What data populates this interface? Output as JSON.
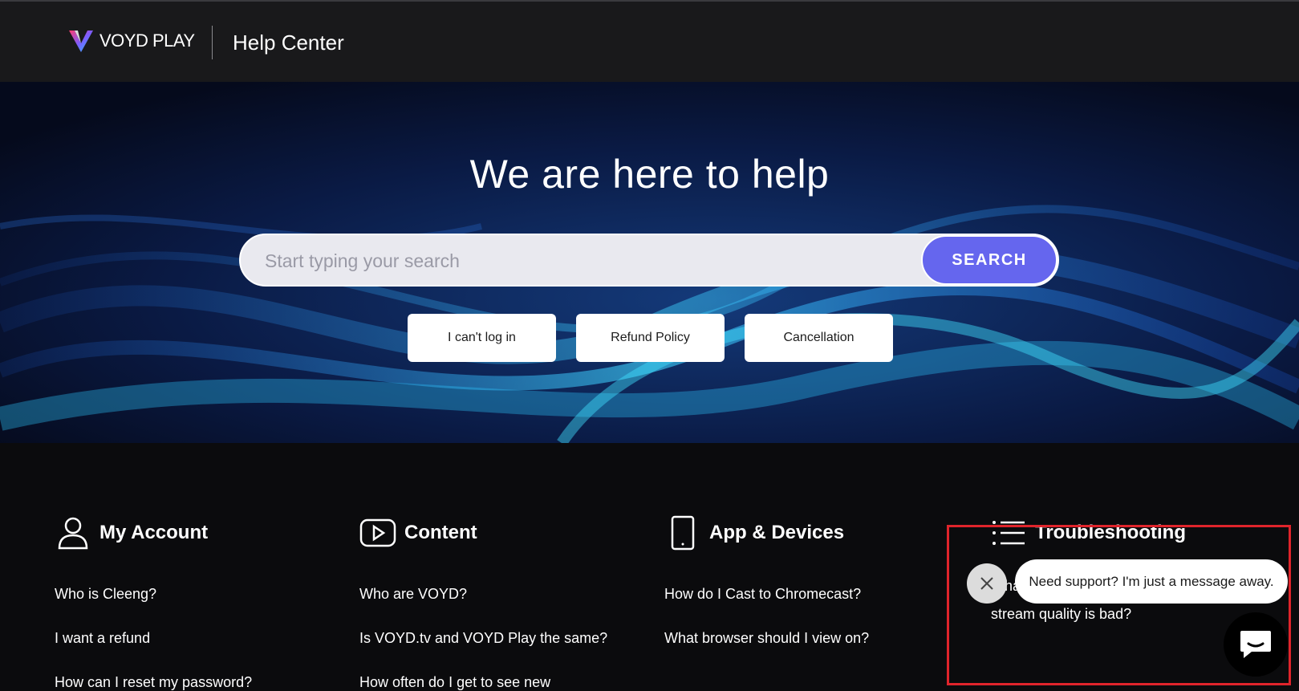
{
  "header": {
    "brand": "VOYD PLAY",
    "section": "Help Center"
  },
  "hero": {
    "title": "We are here to help",
    "search_placeholder": "Start typing your search",
    "search_button": "SEARCH",
    "quick_links": [
      "I can't log in",
      "Refund Policy",
      "Cancellation"
    ]
  },
  "categories": [
    {
      "title": "My Account",
      "icon": "user-icon",
      "items": [
        "Who is Cleeng?",
        "I want a refund",
        "How can I reset my password?"
      ]
    },
    {
      "title": "Content",
      "icon": "play-icon",
      "items": [
        "Who are VOYD?",
        "Is VOYD.tv and VOYD Play the same?",
        "How often do I get to see new"
      ]
    },
    {
      "title": "App & Devices",
      "icon": "phone-icon",
      "items": [
        "How do I Cast to Chromecast?",
        "What browser should I view on?"
      ]
    },
    {
      "title": "Troubleshooting",
      "icon": "list-icon",
      "items": [
        "What",
        "stream quality is bad?"
      ]
    }
  ],
  "chat": {
    "message": "Need support? I'm just a message away.",
    "close_icon": "close-icon",
    "button_icon": "chat-icon"
  },
  "colors": {
    "accent": "#6566ee",
    "header_bg": "#19191b",
    "page_bg": "#0b0b0d",
    "highlight": "#e0242b"
  }
}
